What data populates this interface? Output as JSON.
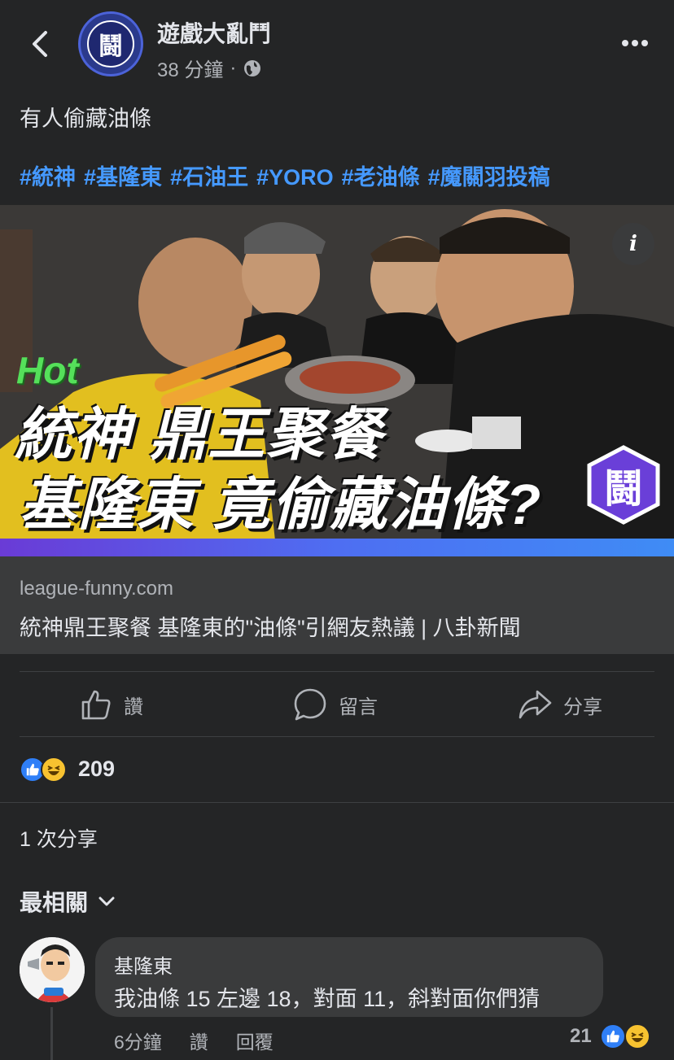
{
  "header": {
    "page_name": "遊戲大亂鬥",
    "time": "38 分鐘",
    "separator": "·",
    "avatar_glyph": "鬪"
  },
  "post": {
    "text": "有人偷藏油條",
    "hashtags": [
      "#統神",
      "#基隆東",
      "#石油王",
      "#YORO",
      "#老油條",
      "#魔關羽投稿"
    ],
    "image": {
      "hot_label": "Hot",
      "headline_line1": "統神 鼎王聚餐",
      "headline_line2": "基隆東 竟偷藏油條?",
      "badge_glyph": "鬪",
      "info_glyph": "i"
    },
    "link": {
      "domain": "league-funny.com",
      "title": "統神鼎王聚餐 基隆東的\"油條\"引網友熱議 | 八卦新聞"
    }
  },
  "actions": {
    "like": "讚",
    "comment": "留言",
    "share": "分享"
  },
  "reactions": {
    "count": "209",
    "types": [
      "like-icon",
      "haha-icon"
    ]
  },
  "shares": "1 次分享",
  "sort": {
    "label": "最相關"
  },
  "comment": {
    "author": "基隆東",
    "text": "我油條 15 左邊 18，對面 11，斜對面你們猜",
    "time": "6分鐘",
    "like": "讚",
    "reply": "回覆",
    "reaction_count": "21"
  },
  "colors": {
    "background": "#242526",
    "hashtag": "#4599ff",
    "link_box": "#3a3b3c",
    "like_blue": "#2f7ff7",
    "haha_yellow": "#f7c230"
  }
}
